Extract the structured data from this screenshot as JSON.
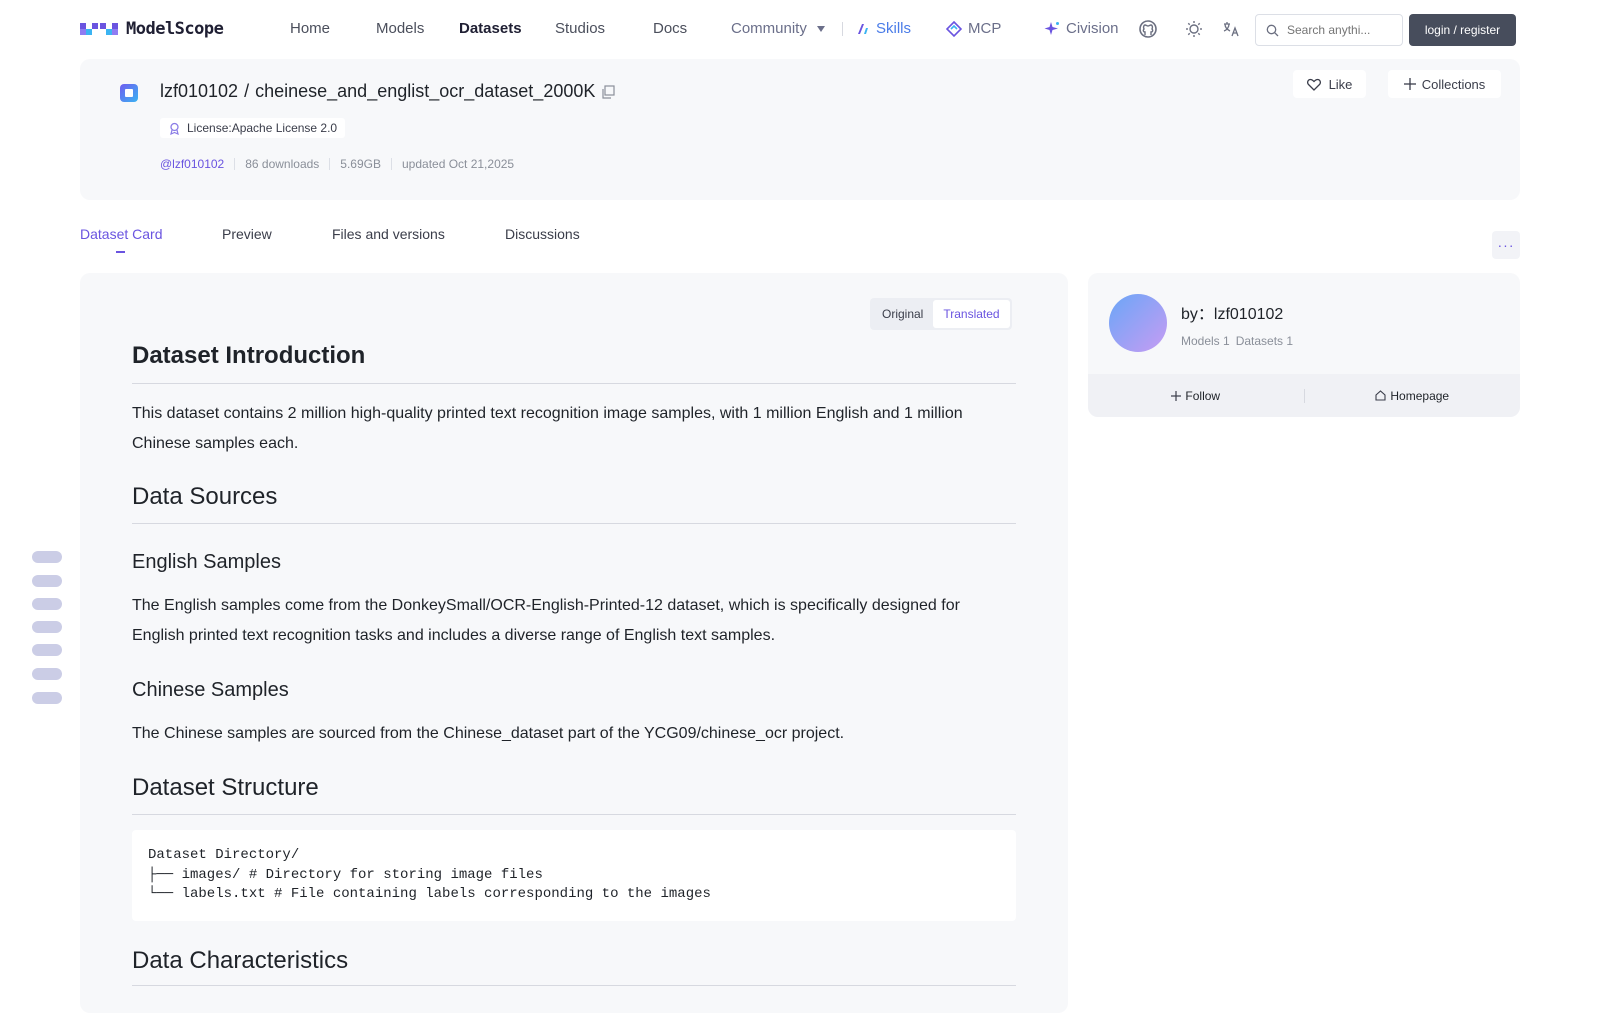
{
  "nav": {
    "logo_text": "ModelScope",
    "items": [
      "Home",
      "Models",
      "Datasets",
      "Studios",
      "Docs"
    ],
    "community": "Community",
    "skills": "Skills",
    "mcp": "MCP",
    "civision": "Civision",
    "search_placeholder": "Search anythi...",
    "login": "login / register"
  },
  "header": {
    "owner": "lzf010102",
    "separator": "/",
    "name": "cheinese_and_englist_ocr_dataset_2000K",
    "license": "License:Apache License 2.0",
    "owner_handle": "@lzf010102",
    "downloads": "86 downloads",
    "size": "5.69GB",
    "updated": "updated Oct 21,2025",
    "like": "Like",
    "collections": "Collections"
  },
  "tabs": [
    "Dataset Card",
    "Preview",
    "Files and versions",
    "Discussions"
  ],
  "more": "···",
  "lang_toggle": {
    "original": "Original",
    "translated": "Translated"
  },
  "card": {
    "h_intro": "Dataset Introduction",
    "p_intro": "This dataset contains 2 million high-quality printed text recognition image samples, with 1 million English and 1 million Chinese samples each.",
    "h_sources": "Data Sources",
    "h_english": "English Samples",
    "p_english": "The English samples come from the DonkeySmall/OCR-English-Printed-12 dataset, which is specifically designed for English printed text recognition tasks and includes a diverse range of English text samples.",
    "h_chinese": "Chinese Samples",
    "p_chinese": "The Chinese samples are sourced from the Chinese_dataset part of the YCG09/chinese_ocr project.",
    "h_structure": "Dataset Structure",
    "code": "Dataset Directory/\n├── images/ # Directory for storing image files\n└── labels.txt # File containing labels corresponding to the images",
    "h_characteristics": "Data Characteristics"
  },
  "author": {
    "name": "by：lzf010102",
    "models": "Models 1",
    "datasets": "Datasets 1",
    "follow": "Follow",
    "homepage": "Homepage"
  },
  "colors": {
    "accent": "#6a54e0",
    "panel": "#f7f8fa",
    "login_bg": "#474d5c"
  }
}
